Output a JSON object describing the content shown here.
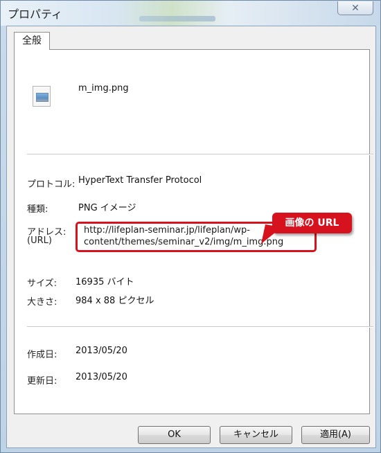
{
  "window": {
    "title": "プロパティ",
    "close_symbol": "✕"
  },
  "tab": {
    "label": "全般"
  },
  "file": {
    "name": "m_img.png",
    "icon": "image-file-icon"
  },
  "props": {
    "protocol_label": "プロトコル:",
    "protocol_value": "HyperText Transfer Protocol",
    "type_label": "種類:",
    "type_value": "PNG イメージ",
    "address_label_1": "アドレス:",
    "address_label_2": "(URL)",
    "address_line_1": "http://lifeplan-seminar.jp/lifeplan/wp-",
    "address_line_2": "content/themes/seminar_v2/img/m_img.png",
    "size_label": "サイズ:",
    "size_value": "16935 バイト",
    "dimensions_label": "大きさ:",
    "dimensions_value": "984  x  88  ピクセル",
    "created_label": "作成日:",
    "created_value": "2013/05/20",
    "modified_label": "更新日:",
    "modified_value": "2013/05/20"
  },
  "annotation": {
    "callout_text": "画像の URL",
    "color": "#d6121e"
  },
  "buttons": {
    "ok": "OK",
    "cancel": "キャンセル",
    "apply": "適用(A)"
  }
}
